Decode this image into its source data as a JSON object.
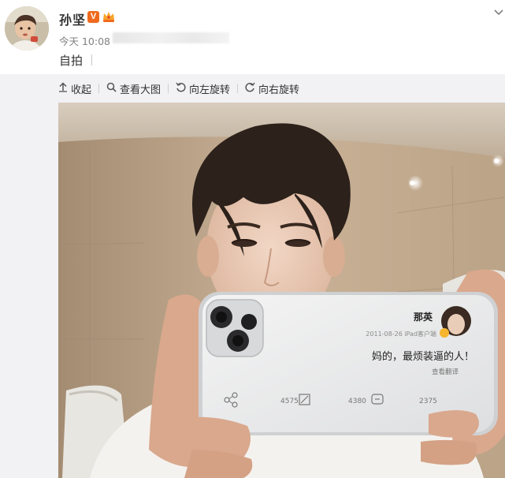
{
  "user": {
    "name": "孙坚",
    "verified_badge": "V"
  },
  "post": {
    "timestamp": "今天 10:08",
    "text": "自拍"
  },
  "toolbar": {
    "collapse_label": "收起",
    "view_large_label": "查看大图",
    "rotate_left_label": "向左旋转",
    "rotate_right_label": "向右旋转"
  },
  "phone_screen": {
    "profile_name": "那英",
    "meta": "2011-08-26   iPad客户端",
    "post_text": "妈的，最烦装逼的人！",
    "translate_label": "查看翻译",
    "stat_repost": "4575",
    "stat_comment": "4380",
    "stat_like": "2375"
  },
  "icons": {
    "collapse": "arrow-up-icon",
    "view_large": "magnifier-icon",
    "rotate_left": "rotate-left-icon",
    "rotate_right": "rotate-right-icon",
    "menu": "chevron-down-icon",
    "crown": "crown-badge-icon"
  },
  "colors": {
    "badge_orange": "#f06a1d",
    "media_background": "#f2f2f5",
    "text_primary": "#333333",
    "text_secondary": "#808080"
  }
}
